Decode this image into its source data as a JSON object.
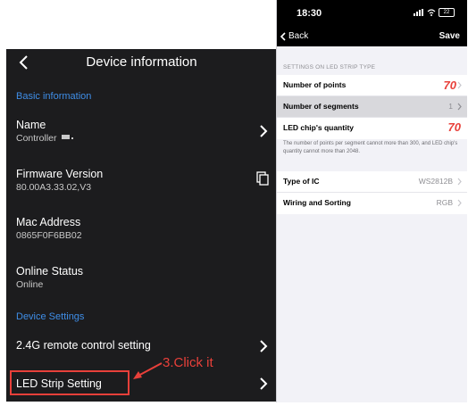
{
  "left": {
    "title": "Device information",
    "section_basic": "Basic information",
    "name_label": "Name",
    "name_value": "Controller",
    "firmware_label": "Firmware Version",
    "firmware_value": "80.00A3.33.02,V3",
    "mac_label": "Mac Address",
    "mac_value": "0865F0F6BB02",
    "online_label": "Online Status",
    "online_value": "Online",
    "section_device": "Device Settings",
    "remote_label": "2.4G remote control setting",
    "led_label": "LED Strip Setting",
    "annotation": "3.Click it"
  },
  "right": {
    "time": "18:30",
    "battery": "22",
    "back": "Back",
    "save": "Save",
    "section_caption": "SETTINGS ON LED STRIP TYPE",
    "points_label": "Number of points",
    "points_value": "70",
    "segments_label": "Number of segments",
    "segments_value": "1",
    "chip_label": "LED chip's quantity",
    "chip_value": "70",
    "note": "The number of points per segment cannot more than 300, and LED chip's quantity cannot  more than 2048.",
    "ic_label": "Type of IC",
    "ic_value": "WS2812B",
    "wiring_label": "Wiring and Sorting",
    "wiring_value": "RGB"
  },
  "colors": {
    "accent_blue": "#3f8ee8",
    "annotation_red": "#e8403a"
  }
}
